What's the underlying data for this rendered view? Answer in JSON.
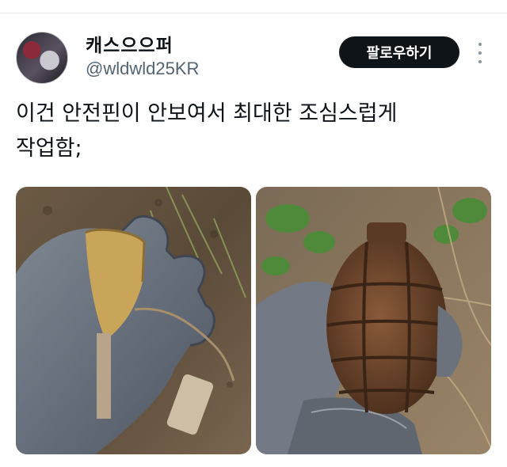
{
  "tweet": {
    "author": {
      "display_name": "캐스으으퍼",
      "handle": "@wldwld25KR",
      "avatar_icon": "avatar-image"
    },
    "follow_label": "팔로우하기",
    "more_icon": "vertical-dots-icon",
    "text_lines": [
      "이건 안전핀이 안보여서 최대한 조심스럽게",
      "작업함;"
    ],
    "media": [
      {
        "description_icon": "photo-gloved-hand-holding-grenade-fuse"
      },
      {
        "description_icon": "photo-gloved-hand-holding-rusted-grenade"
      }
    ]
  },
  "colors": {
    "text": "#0f1419",
    "secondary": "#536471",
    "follow_bg": "#0f1419",
    "divider": "#e7e9ea"
  }
}
